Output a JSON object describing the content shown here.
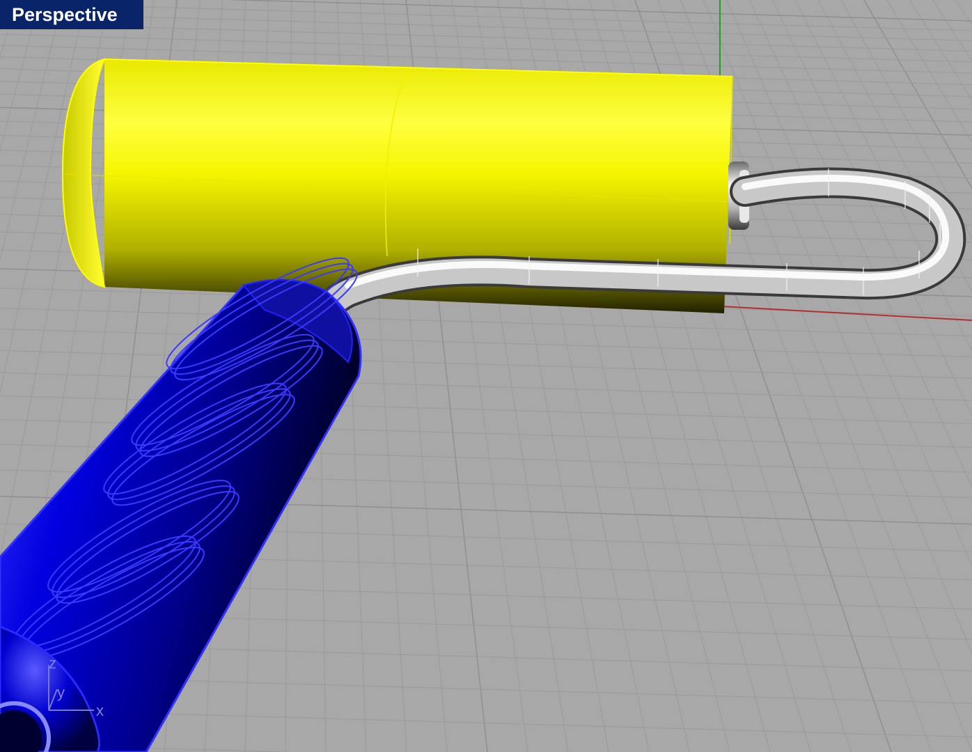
{
  "viewport": {
    "title": "Perspective"
  },
  "axis_indicator": {
    "x_label": "x",
    "y_label": "y",
    "z_label": "z"
  },
  "objects": [
    {
      "name": "roller-cover",
      "color": "#f2f200"
    },
    {
      "name": "roller-frame-wire",
      "color": "#d4d4d4"
    },
    {
      "name": "handle-grip",
      "color": "#0000cc"
    }
  ],
  "colors": {
    "grid_background": "#a8a8a8",
    "grid_line": "#9a9a9a",
    "grid_major": "#8f8f8f",
    "x_axis": "#b03030",
    "y_axis": "#2a9a2a",
    "title_bar": "#0a246a",
    "title_text": "#ffffff"
  }
}
